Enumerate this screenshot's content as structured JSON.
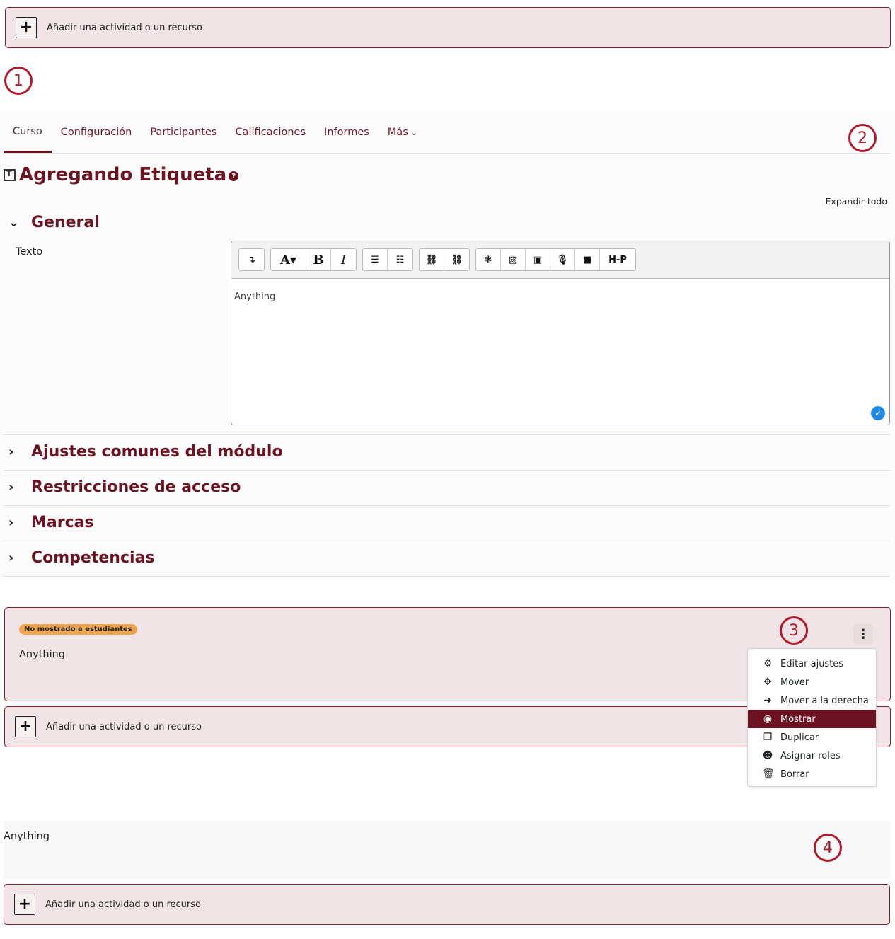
{
  "add_activity_label": "Añadir una actividad o un recurso",
  "callouts": [
    "1",
    "2",
    "3",
    "4"
  ],
  "nav_tabs": [
    {
      "label": "Curso",
      "active": true
    },
    {
      "label": "Configuración",
      "active": false
    },
    {
      "label": "Participantes",
      "active": false
    },
    {
      "label": "Calificaciones",
      "active": false
    },
    {
      "label": "Informes",
      "active": false
    },
    {
      "label": "Más",
      "active": false
    }
  ],
  "page_title": "Agregando Etiqueta",
  "expand_all": "Expandir todo",
  "sections": {
    "general": "General",
    "common": "Ajustes comunes del módulo",
    "restrictions": "Restricciones de acceso",
    "tags": "Marcas",
    "competencies": "Competencias"
  },
  "field": {
    "text_label": "Texto",
    "content": "Anything"
  },
  "editor_toolbar": {
    "expand": "↴",
    "font": "A▾",
    "bold": "B",
    "italic": "I",
    "ul": "☰",
    "ol": "☷",
    "link": "⛓",
    "unlink": "⛓",
    "media_mgr": "❃",
    "image": "▨",
    "media": "▣",
    "record_audio": "🎙",
    "record_video": "■",
    "h5p": "H-P"
  },
  "label_card": {
    "badge": "No mostrado a estudiantes",
    "text": "Anything",
    "kebab": "⋮"
  },
  "menu": [
    {
      "icon": "gear-icon",
      "glyph": "⚙",
      "label": "Editar ajustes",
      "active": false
    },
    {
      "icon": "move-icon",
      "glyph": "✥",
      "label": "Mover",
      "active": false
    },
    {
      "icon": "arrow-right-icon",
      "glyph": "➜",
      "label": "Mover a la derecha",
      "active": false
    },
    {
      "icon": "eye-slash-icon",
      "glyph": "◉",
      "label": "Mostrar",
      "active": true
    },
    {
      "icon": "copy-icon",
      "glyph": "❐",
      "label": "Duplicar",
      "active": false
    },
    {
      "icon": "user-circle-icon",
      "glyph": "☻",
      "label": "Asignar roles",
      "active": false
    },
    {
      "icon": "trash-icon",
      "glyph": "🗑",
      "label": "Borrar",
      "active": false
    }
  ],
  "plain_text": "Anything",
  "colors": {
    "brand": "#6b1321",
    "callout": "#b21a2b",
    "badge": "#f0a64c",
    "card_bg": "#f0e4e6"
  }
}
